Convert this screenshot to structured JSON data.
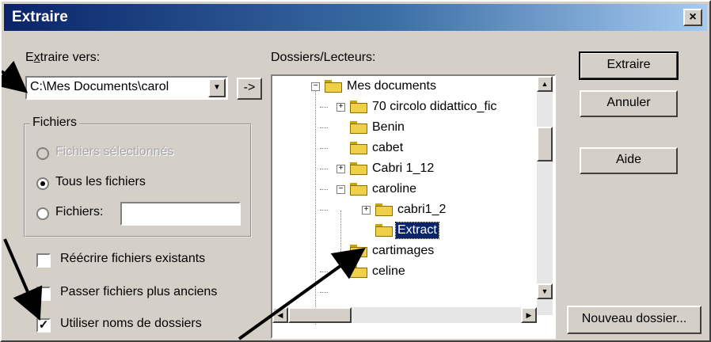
{
  "dialog": {
    "title": "Extraire",
    "close_label": "×"
  },
  "extract_to": {
    "label": "Extraire vers:",
    "label_mnemonic": "x",
    "value": "C:\\Mes Documents\\carol",
    "dropdown_arrow": "▼",
    "browse_label": "->"
  },
  "files_group": {
    "title": "Fichiers",
    "selected_files": {
      "label": "Fichiers sélectionnés",
      "checked": false,
      "disabled": true
    },
    "all_files": {
      "label": "Tous les fichiers",
      "checked": true
    },
    "files_pattern": {
      "label": "Fichiers:",
      "value": "",
      "checked": false
    }
  },
  "options": {
    "overwrite": {
      "label": "Réécrire fichiers existants",
      "checked": false
    },
    "skip_older": {
      "label": "Passer fichiers plus anciens",
      "checked": false
    },
    "use_folder_names": {
      "label": "Utiliser noms de dossiers",
      "checked": true,
      "mark": "✓"
    }
  },
  "folders": {
    "label": "Dossiers/Lecteurs:",
    "tree": [
      {
        "label": "Mes documents",
        "expander": "−",
        "open": true
      },
      {
        "label": "70 circolo didattico_fic",
        "expander": "+"
      },
      {
        "label": "Benin"
      },
      {
        "label": "cabet"
      },
      {
        "label": "Cabri 1_12",
        "expander": "+"
      },
      {
        "label": "caroline",
        "expander": "−",
        "open": true
      },
      {
        "label": "cabri1_2",
        "expander": "+"
      },
      {
        "label": "Extract",
        "selected": true,
        "open": true
      },
      {
        "label": "cartimages"
      },
      {
        "label": "celine"
      }
    ],
    "scroll_up": "▲",
    "scroll_down": "▼",
    "scroll_left": "◀",
    "scroll_right": "▶"
  },
  "buttons": {
    "extract": "Extraire",
    "cancel": "Annuler",
    "help": "Aide",
    "new_folder": "Nouveau dossier..."
  },
  "colors": {
    "title_gradient_start": "#0a246a",
    "title_gradient_end": "#a6caf0",
    "face": "#d4d0c8",
    "selection": "#0a246a"
  }
}
